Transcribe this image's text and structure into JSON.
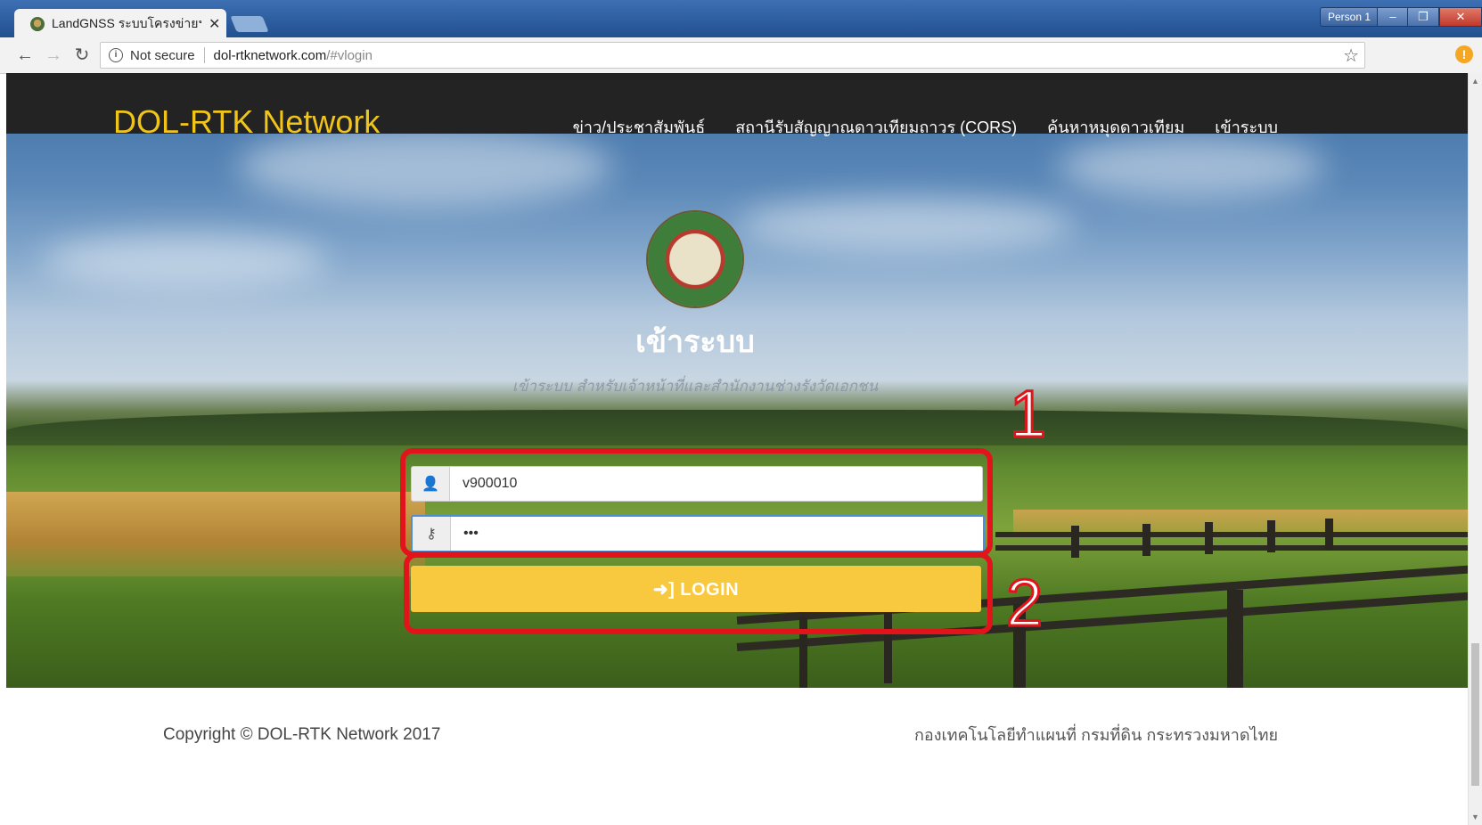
{
  "browser": {
    "tab_title": "LandGNSS ระบบโครงข่ายฯ",
    "tab_close": "✕",
    "profile": "Person 1",
    "security_label": "Not secure",
    "url_host": "dol-rtknetwork.com",
    "url_path": "/#vlogin",
    "window_minimize": "–",
    "window_restore": "❐",
    "window_close": "✕"
  },
  "site": {
    "brand": "DOL-RTK Network",
    "menu": [
      "ข่าว/ประชาสัมพันธ์",
      "สถานีรับสัญญาณดาวเทียมถาวร (CORS)",
      "ค้นหาหมุดดาวเทียม",
      "เข้าระบบ"
    ]
  },
  "login": {
    "title": "เข้าระบบ",
    "subtitle": "เข้าระบบ สำหรับเจ้าหน้าที่และสำนักงานช่างรังวัดเอกชน",
    "username_value": "v900010",
    "password_value": "•••",
    "button_label": "LOGIN",
    "button_icon": "sign-in-icon"
  },
  "annotations": {
    "step1": "1",
    "step2": "2",
    "color": "#e2141b"
  },
  "footer": {
    "copyright": "Copyright © DOL-RTK Network 2017",
    "agency": "กองเทคโนโลยีทำแผนที่ กรมที่ดิน กระทรวงมหาดไทย"
  },
  "colors": {
    "brand": "#f0c419",
    "navbar": "#232323",
    "login_button": "#f8c93e"
  }
}
